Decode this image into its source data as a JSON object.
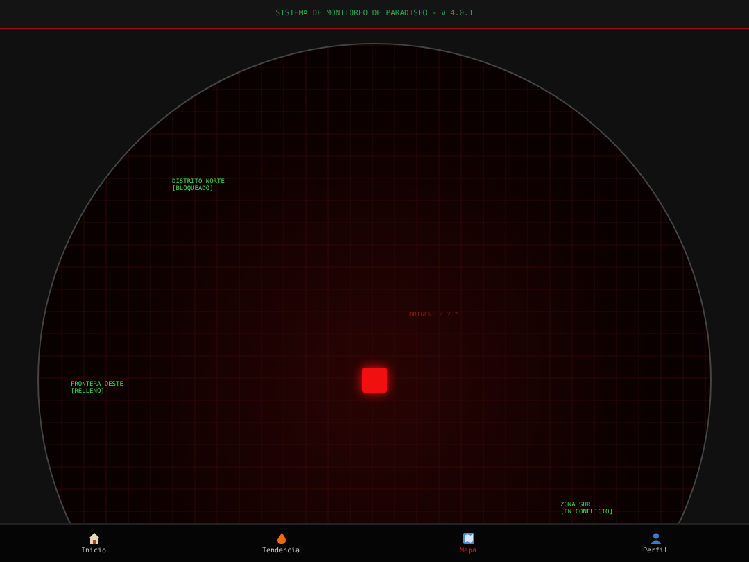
{
  "header": {
    "title": "SISTEMA DE MONITOREO DE PARADISEO - V 4.0.1"
  },
  "map": {
    "zones": [
      {
        "name": "DISTRITO NORTE",
        "status": "[BLOQUEADO]"
      },
      {
        "name": "FRONTERA OESTE",
        "status": "[RELLENO]"
      },
      {
        "name": "ZONA SUR",
        "status": "[EN CONFLICTO]"
      }
    ],
    "origin_label": "ORIGEN: ?.?.?"
  },
  "nav": [
    {
      "label": "Inicio",
      "selected": false
    },
    {
      "label": "Tendencia",
      "selected": false
    },
    {
      "label": "Mapa",
      "selected": true
    },
    {
      "label": "Perfil",
      "selected": false
    }
  ]
}
